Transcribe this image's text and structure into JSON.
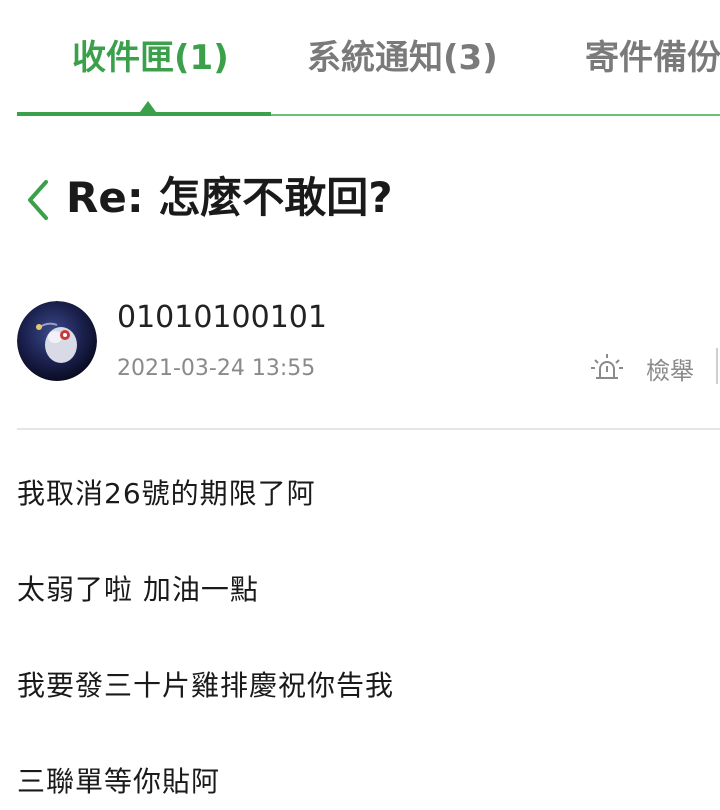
{
  "tabs": [
    {
      "label": "收件匣(1)",
      "active": true
    },
    {
      "label": "系統通知(3)",
      "active": false
    },
    {
      "label": "寄件備份",
      "active": false
    }
  ],
  "message": {
    "title": "Re: 怎麼不敢回?",
    "sender": "01010100101",
    "date": "2021-03-24 13:55",
    "report_label": "檢舉",
    "body": [
      "我取消26號的期限了阿",
      "太弱了啦 加油一點",
      "我要發三十片雞排慶祝你告我",
      "三聯單等你貼阿"
    ]
  },
  "icons": {
    "back": "chevron-left-icon",
    "report": "siren-icon"
  },
  "colors": {
    "accent": "#3aa04a",
    "inactive_tab": "#7a7a7a",
    "muted_text": "#8a8a8a"
  }
}
